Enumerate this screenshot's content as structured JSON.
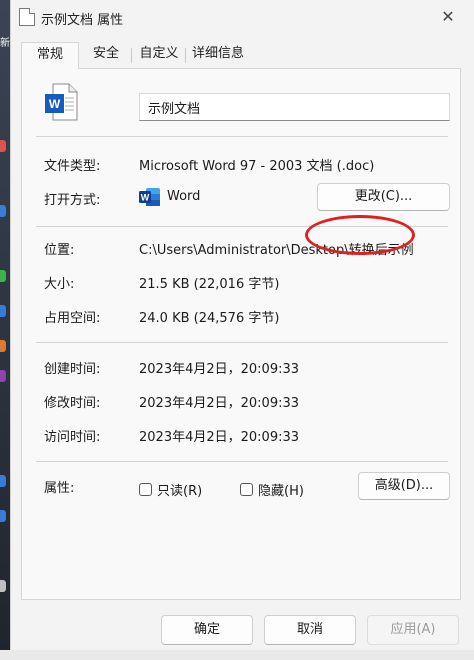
{
  "window": {
    "title": "示例文档 属性"
  },
  "desktop_text": "新",
  "tabs": [
    {
      "label": "常规",
      "active": true
    },
    {
      "label": "安全"
    },
    {
      "label": "自定义"
    },
    {
      "label": "详细信息"
    }
  ],
  "general": {
    "file_name": "示例文档",
    "file_type_label": "文件类型:",
    "file_type_value": "Microsoft Word 97 - 2003 文档 (.doc)",
    "opens_with_label": "打开方式:",
    "opens_with_value": "Word",
    "change_button": "更改(C)...",
    "location_label": "位置:",
    "location_value": "C:\\Users\\Administrator\\Desktop\\转换后示例",
    "size_label": "大小:",
    "size_value": "21.5 KB (22,016 字节)",
    "size_on_disk_label": "占用空间:",
    "size_on_disk_value": "24.0 KB (24,576 字节)",
    "created_label": "创建时间:",
    "created_value": "2023年4月2日，20:09:33",
    "modified_label": "修改时间:",
    "modified_value": "2023年4月2日，20:09:33",
    "accessed_label": "访问时间:",
    "accessed_value": "2023年4月2日，20:09:33",
    "attributes_label": "属性:",
    "readonly_label": "只读(R)",
    "hidden_label": "隐藏(H)",
    "advanced_button": "高级(D)..."
  },
  "footer": {
    "ok": "确定",
    "cancel": "取消",
    "apply": "应用(A)"
  },
  "colors": {
    "annotation_circle": "#e02020",
    "word_blue": "#185abd"
  }
}
